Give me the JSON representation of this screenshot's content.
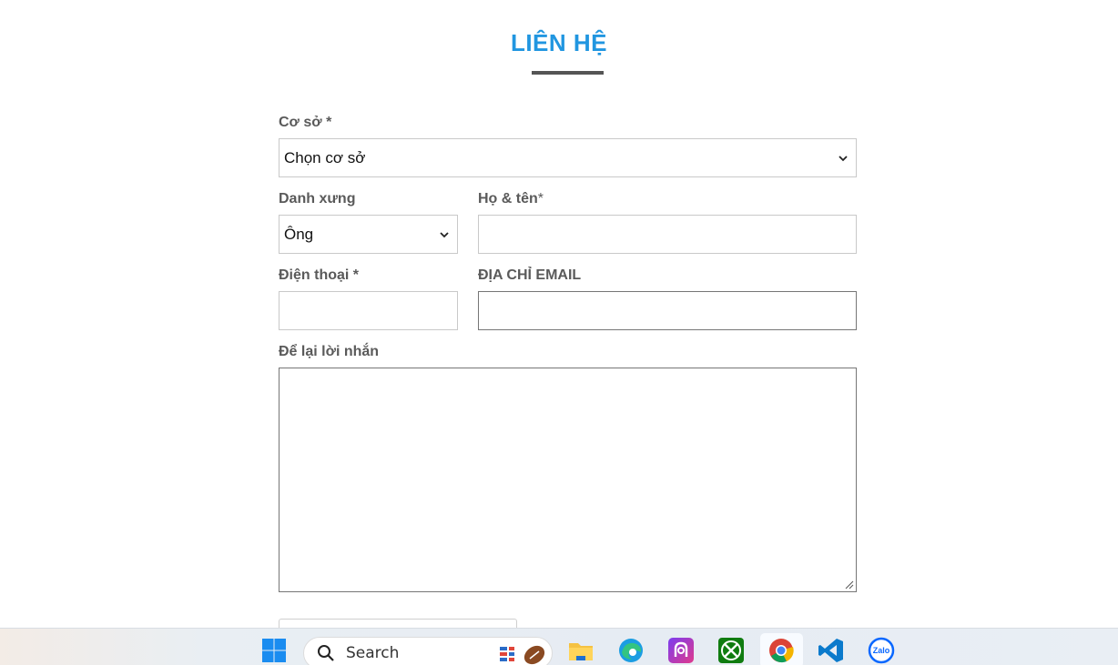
{
  "header": {
    "title": "LIÊN HỆ"
  },
  "form": {
    "branch": {
      "label": "Cơ sở *",
      "value": "Chọn cơ sở"
    },
    "salutation": {
      "label": "Danh xưng",
      "value": "Ông"
    },
    "fullname": {
      "label_main": "Họ & tên",
      "label_star": "*",
      "value": ""
    },
    "phone": {
      "label": "Điện thoại *",
      "value": ""
    },
    "email": {
      "label": "ĐỊA CHỈ EMAIL",
      "value": ""
    },
    "message": {
      "label": "Để lại lời nhắn",
      "value": ""
    }
  },
  "taskbar": {
    "search_label": "Search",
    "apps": [
      "windows-start-icon",
      "widgets-icon",
      "file-explorer-icon",
      "edge-icon",
      "app-icon",
      "xbox-icon",
      "chrome-icon",
      "vscode-icon",
      "zalo-icon"
    ],
    "zalo_text": "Zalo"
  },
  "colors": {
    "title": "#2196e0",
    "label": "#5a5a5a",
    "border": "#c9c9c9"
  }
}
